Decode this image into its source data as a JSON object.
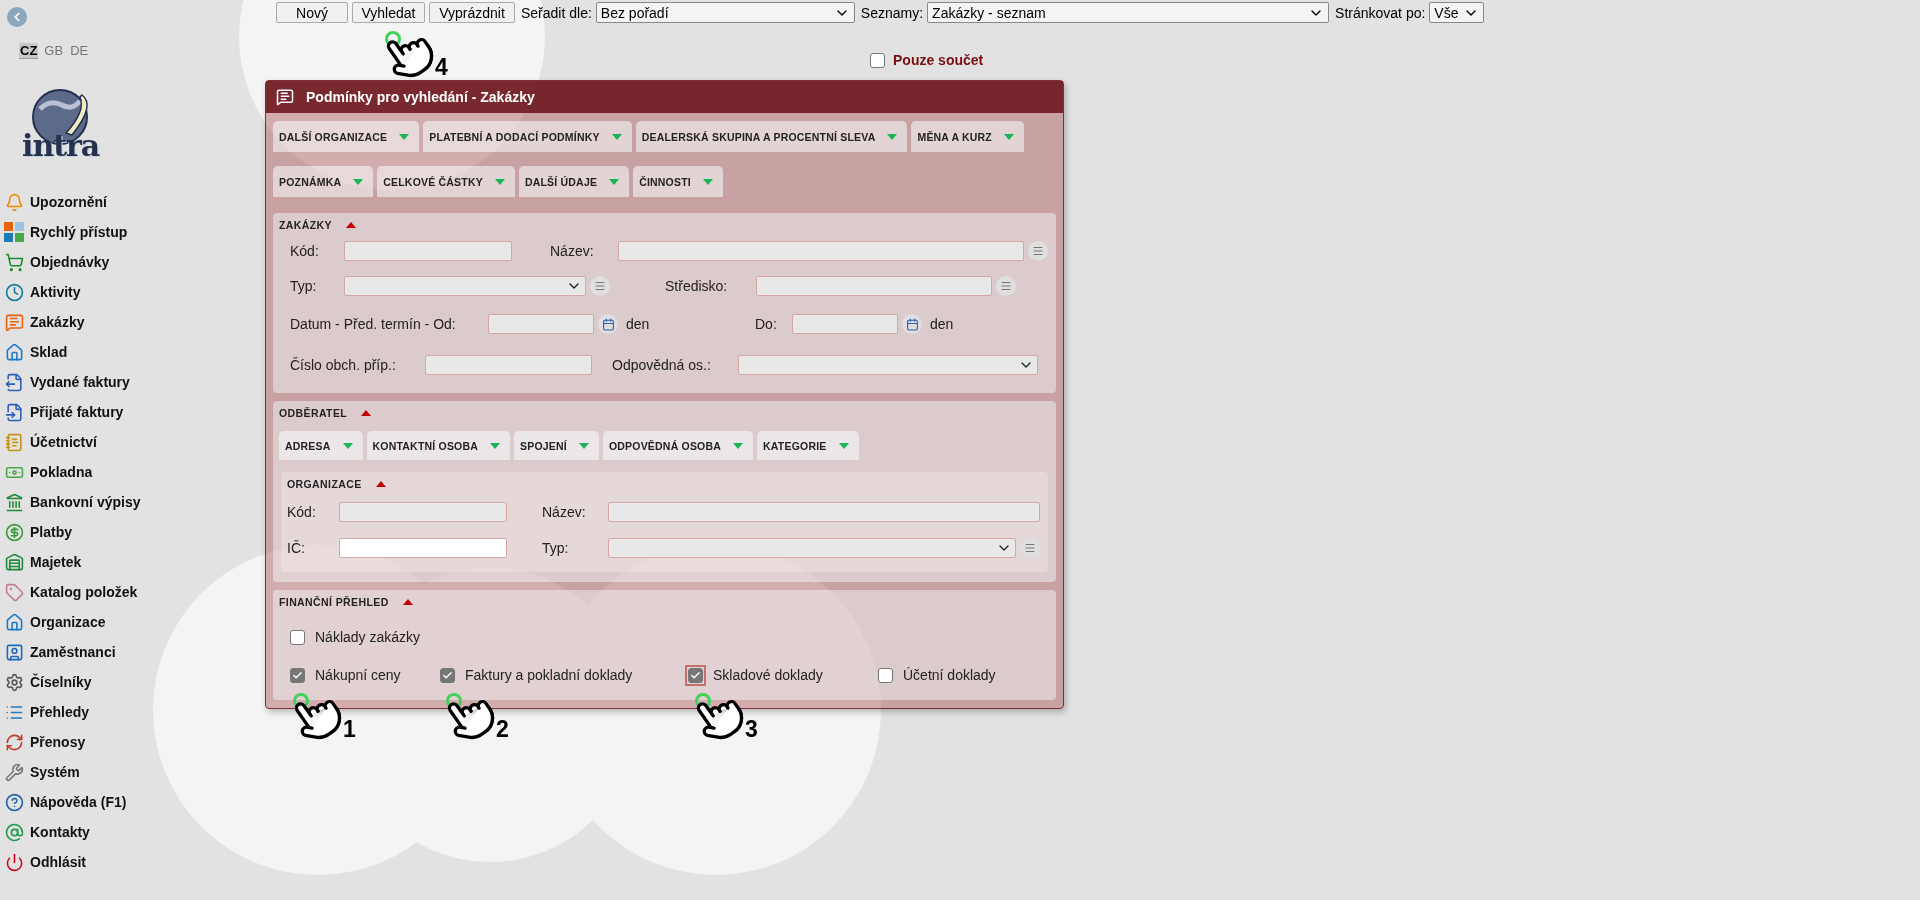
{
  "languages": [
    {
      "label": "CZ",
      "selected": true
    },
    {
      "label": "GB",
      "selected": false
    },
    {
      "label": "DE",
      "selected": false
    }
  ],
  "logo": {
    "text": "intra"
  },
  "menu": [
    {
      "label": "Upozornění"
    },
    {
      "label": "Rychlý přístup"
    },
    {
      "label": "Objednávky"
    },
    {
      "label": "Aktivity"
    },
    {
      "label": "Zakázky"
    },
    {
      "label": "Sklad"
    },
    {
      "label": "Vydané faktury"
    },
    {
      "label": "Přijaté faktury"
    },
    {
      "label": "Účetnictví"
    },
    {
      "label": "Pokladna"
    },
    {
      "label": "Bankovní výpisy"
    },
    {
      "label": "Platby"
    },
    {
      "label": "Majetek"
    },
    {
      "label": "Katalog položek"
    },
    {
      "label": "Organizace"
    },
    {
      "label": "Zaměstnanci"
    },
    {
      "label": "Číselníky"
    },
    {
      "label": "Přehledy"
    },
    {
      "label": "Přenosy"
    },
    {
      "label": "Systém"
    },
    {
      "label": "Nápověda (F1)"
    },
    {
      "label": "Kontakty"
    },
    {
      "label": "Odhlásit"
    }
  ],
  "toolbar": {
    "buttons": [
      "Nový",
      "Vyhledat",
      "Vyprázdnit"
    ],
    "sort": {
      "label": "Seřadit dle:",
      "value": "Bez pořadí"
    },
    "lists": {
      "label": "Seznamy:",
      "value": "Zakázky - seznam"
    },
    "paging": {
      "label": "Stránkovat po:",
      "value": "Vše"
    }
  },
  "total_only": {
    "label": "Pouze součet",
    "checked": false
  },
  "panel": {
    "title": "Podmínky pro vyhledání - Zakázky",
    "tab_rows": [
      [
        {
          "label": "DALŠÍ ORGANIZACE",
          "expanded": false
        },
        {
          "label": "PLATEBNÍ A DODACÍ PODMÍNKY",
          "expanded": false
        },
        {
          "label": "DEALERSKÁ SKUPINA A PROCENTNÍ SLEVA",
          "expanded": false
        },
        {
          "label": "MĚNA A KURZ",
          "expanded": false
        }
      ],
      [
        {
          "label": "POZNÁMKA",
          "expanded": false
        },
        {
          "label": "CELKOVÉ ČÁSTKY",
          "expanded": false
        },
        {
          "label": "DALŠÍ ÚDAJE",
          "expanded": false
        },
        {
          "label": "ČINNOSTI",
          "expanded": false
        }
      ]
    ],
    "orders": {
      "title": "ZAKÁZKY",
      "expanded": true,
      "rows": [
        [
          {
            "label": "Kód:",
            "kind": "text",
            "list_button": false,
            "focused": false
          },
          {
            "label": "Název:",
            "kind": "text",
            "list_button": true,
            "focused": false
          }
        ],
        [
          {
            "label": "Typ:",
            "kind": "select",
            "list_button": true,
            "focused": false
          },
          {
            "label": "Středisko:",
            "kind": "text",
            "list_button": true,
            "focused": false
          }
        ],
        [
          {
            "label": "Datum - Před. termín - Od:",
            "kind": "date",
            "suffix": "den",
            "list_button": false,
            "focused": false
          },
          {
            "label": "Do:",
            "kind": "date",
            "suffix": "den",
            "list_button": false,
            "focused": false
          }
        ],
        [
          {
            "label": "Číslo obch. příp.:",
            "kind": "text",
            "list_button": false,
            "focused": false
          },
          {
            "label": "Odpovědná os.:",
            "kind": "select",
            "list_button": false,
            "focused": false
          }
        ]
      ]
    },
    "customer": {
      "title": "ODBĚRATEL",
      "expanded": true,
      "tabs": [
        {
          "label": "ADRESA",
          "expanded": false
        },
        {
          "label": "KONTAKTNÍ OSOBA",
          "expanded": false
        },
        {
          "label": "SPOJENÍ",
          "expanded": false
        },
        {
          "label": "ODPOVĚDNÁ OSOBA",
          "expanded": false
        },
        {
          "label": "KATEGORIE",
          "expanded": false
        }
      ],
      "organization": {
        "title": "ORGANIZACE",
        "expanded": true,
        "rows": [
          [
            {
              "label": "Kód:",
              "kind": "text",
              "list_button": false,
              "focused": false
            },
            {
              "label": "Název:",
              "kind": "text",
              "list_button": false,
              "focused": false
            }
          ],
          [
            {
              "label": "IČ:",
              "kind": "text",
              "list_button": false,
              "focused": true
            },
            {
              "label": "Typ:",
              "kind": "select",
              "list_button": true,
              "focused": false
            }
          ]
        ]
      }
    },
    "finance": {
      "title": "FINANČNÍ PŘEHLED",
      "expanded": true,
      "rows": [
        [
          {
            "label": "Náklady zakázky",
            "checked": false,
            "focused": false
          }
        ],
        [
          {
            "label": "Nákupní ceny",
            "checked": true,
            "focused": false
          },
          {
            "label": "Faktury a pokladní doklady",
            "checked": true,
            "focused": false
          },
          {
            "label": "Skladové doklady",
            "checked": true,
            "focused": true
          },
          {
            "label": "Účetní doklady",
            "checked": false,
            "focused": false
          }
        ]
      ]
    }
  },
  "steps": [
    {
      "number": "1"
    },
    {
      "number": "2"
    },
    {
      "number": "3"
    },
    {
      "number": "4"
    }
  ]
}
